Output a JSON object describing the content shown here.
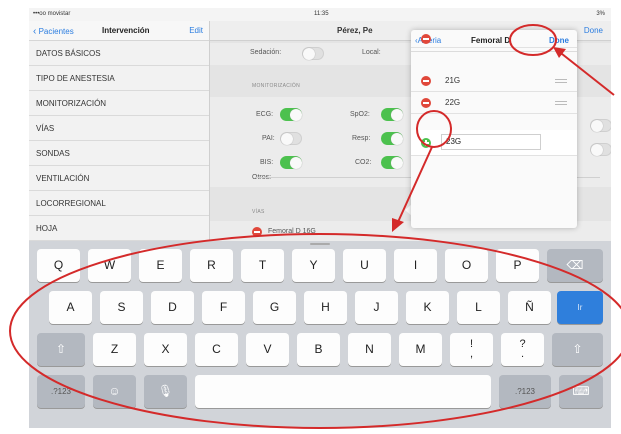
{
  "status_bar": {
    "carrier": "•••oo movistar",
    "time": "11:35",
    "battery": "3%"
  },
  "sidebar": {
    "back_label": "Pacientes",
    "title": "Intervención",
    "edit_label": "Edit",
    "items": [
      {
        "label": "DATOS BÁSICOS"
      },
      {
        "label": "TIPO DE ANESTESIA"
      },
      {
        "label": "MONITORIZACIÓN"
      },
      {
        "label": "VÍAS"
      },
      {
        "label": "SONDAS"
      },
      {
        "label": "VENTILACIÓN"
      },
      {
        "label": "LOCORREGIONAL"
      },
      {
        "label": "HOJA"
      }
    ]
  },
  "main": {
    "title": "Pérez, Pe",
    "done_label": "Done",
    "sedacion_label": "Sedación:",
    "local_label": "Local:",
    "monitorizacion_header": "MONITORIZACIÓN",
    "ecg_label": "ECG:",
    "spo2_label": "SpO2:",
    "pai_label": "PAI:",
    "resp_label": "Resp:",
    "bis_label": "BIS:",
    "co2_label": "CO2:",
    "otros_label": "Otros:",
    "vias_header": "VÍAS",
    "via_item": "Femoral D 16G"
  },
  "popover": {
    "back_label": "Arteria",
    "title": "Femoral D",
    "done_label": "Done",
    "rows": [
      {
        "label": "21G"
      },
      {
        "label": "22G"
      }
    ],
    "new_value": "23G"
  },
  "keyboard": {
    "row1": [
      "Q",
      "W",
      "E",
      "R",
      "T",
      "Y",
      "U",
      "I",
      "O",
      "P"
    ],
    "row2": [
      "A",
      "S",
      "D",
      "F",
      "G",
      "H",
      "J",
      "K",
      "L",
      "Ñ"
    ],
    "row3": [
      "Z",
      "X",
      "C",
      "V",
      "B",
      "N",
      "M"
    ],
    "punct1_top": "!",
    "punct1_bottom": ",",
    "punct2_top": "?",
    "punct2_bottom": ".",
    "numbers_label": ".?123",
    "return_label": "Ir"
  },
  "colors": {
    "accent": "#2b7de0",
    "switch_on": "#4cc14e",
    "delete_red": "#e0473a",
    "annotation_red": "#d42a2a"
  }
}
